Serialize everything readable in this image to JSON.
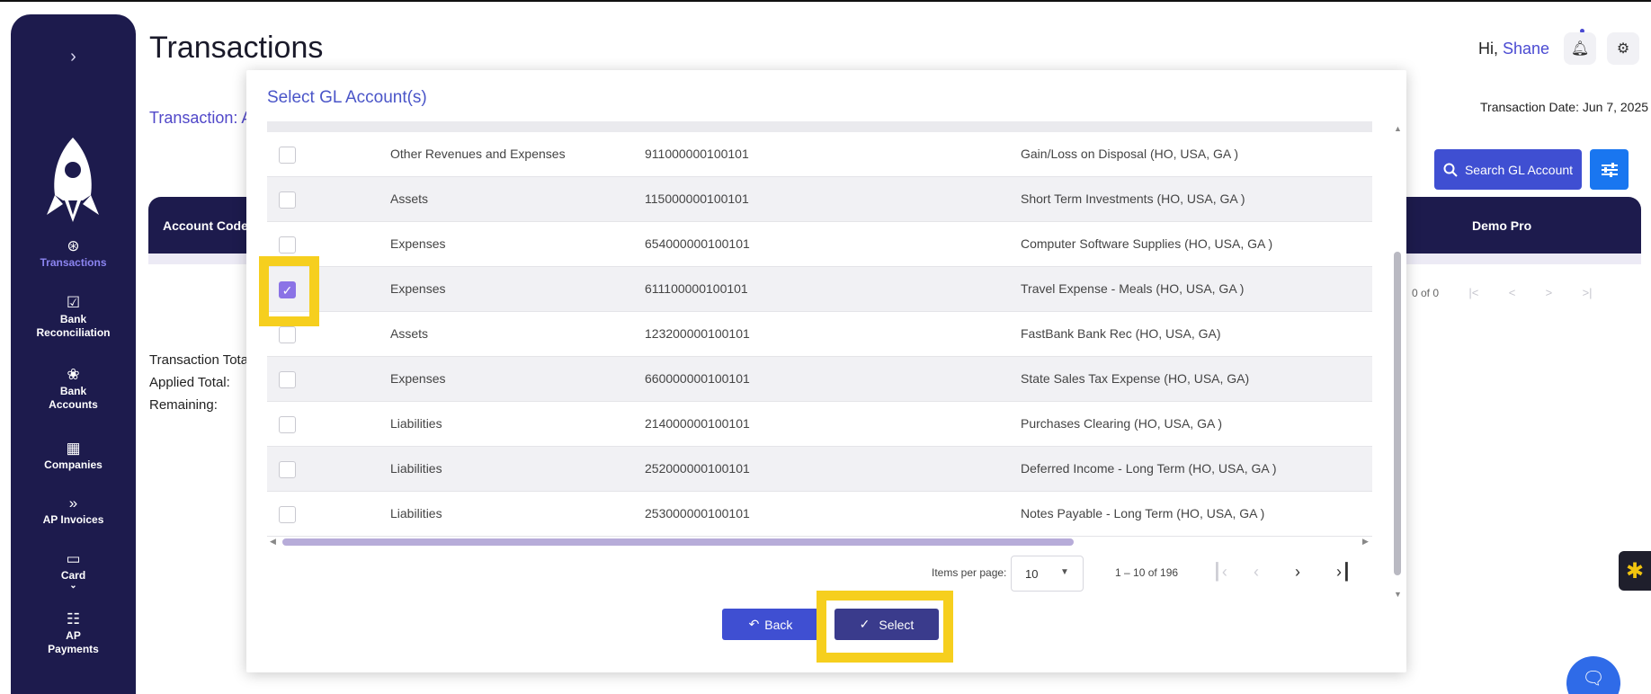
{
  "sidebar": {
    "toggle_icon": "chevron-right-icon",
    "logo": "rocket-logo",
    "items": [
      {
        "label": "Transactions",
        "icon": "dollar-circle-icon",
        "glyph": "⊛",
        "active": true
      },
      {
        "label": "Bank\nReconciliation",
        "icon": "reconcile-icon",
        "glyph": "☑"
      },
      {
        "label": "Bank\nAccounts",
        "icon": "piggy-bank-icon",
        "glyph": "❀"
      },
      {
        "label": "Companies",
        "icon": "building-icon",
        "glyph": "▦"
      },
      {
        "label": "AP Invoices",
        "icon": "double-chevron-icon",
        "glyph": "»"
      },
      {
        "label": "Card",
        "icon": "card-icon",
        "glyph": "▭",
        "sub": "⌄"
      },
      {
        "label": "AP\nPayments",
        "icon": "receipt-icon",
        "glyph": "☷"
      }
    ],
    "colors": {
      "bg": "#1d1b4d",
      "active": "#8b84f0"
    }
  },
  "header": {
    "title": "Transactions",
    "subtitle": "Transaction: A",
    "greeting": "Hi, ",
    "user_name": "Shane",
    "transaction_date": "Transaction Date: Jun 7, 2025",
    "bell_icon": "bell-icon",
    "settings_icon": "gear-icon"
  },
  "toolbar": {
    "search_label": "Search GL Account",
    "search_icon": "search-icon",
    "filter_icon": "sliders-icon"
  },
  "background_table": {
    "col1": "Account Code",
    "col2": "Demo Pro",
    "pager_text": "0 of 0",
    "pager_icons": [
      "|<",
      "<",
      ">",
      ">|"
    ],
    "totals": [
      "Transaction Tota",
      "Applied Total:",
      "Remaining:"
    ]
  },
  "modal": {
    "title": "Select GL Account(s)",
    "rows": [
      {
        "type": "Other Revenues and Expenses",
        "code": "911000000100101",
        "description": "Gain/Loss on Disposal (HO, USA, GA )",
        "checked": false
      },
      {
        "type": "Assets",
        "code": "115000000100101",
        "description": "Short Term Investments (HO, USA, GA )",
        "checked": false
      },
      {
        "type": "Expenses",
        "code": "654000000100101",
        "description": "Computer Software Supplies (HO, USA, GA )",
        "checked": false
      },
      {
        "type": "Expenses",
        "code": "611100000100101",
        "description": "Travel Expense - Meals (HO, USA, GA )",
        "checked": true
      },
      {
        "type": "Assets",
        "code": "123200000100101",
        "description": "FastBank Bank Rec (HO, USA, GA)",
        "checked": false
      },
      {
        "type": "Expenses",
        "code": "660000000100101",
        "description": "State Sales Tax Expense (HO, USA, GA)",
        "checked": false
      },
      {
        "type": "Liabilities",
        "code": "214000000100101",
        "description": "Purchases Clearing (HO, USA, GA )",
        "checked": false
      },
      {
        "type": "Liabilities",
        "code": "252000000100101",
        "description": "Deferred Income - Long Term (HO, USA, GA )",
        "checked": false
      },
      {
        "type": "Liabilities",
        "code": "253000000100101",
        "description": "Notes Payable - Long Term (HO, USA, GA )",
        "checked": false
      }
    ],
    "pagination": {
      "items_per_page_label": "Items per page:",
      "items_per_page_value": "10",
      "range_label": "1 – 10 of 196",
      "first_icon": "|<",
      "prev_icon": "<",
      "next_icon": ">",
      "last_icon": ">|"
    },
    "back_label": "Back",
    "back_icon": "undo-icon",
    "select_label": "Select",
    "select_icon": "check-icon",
    "highlight_color": "#f6cf1e"
  }
}
